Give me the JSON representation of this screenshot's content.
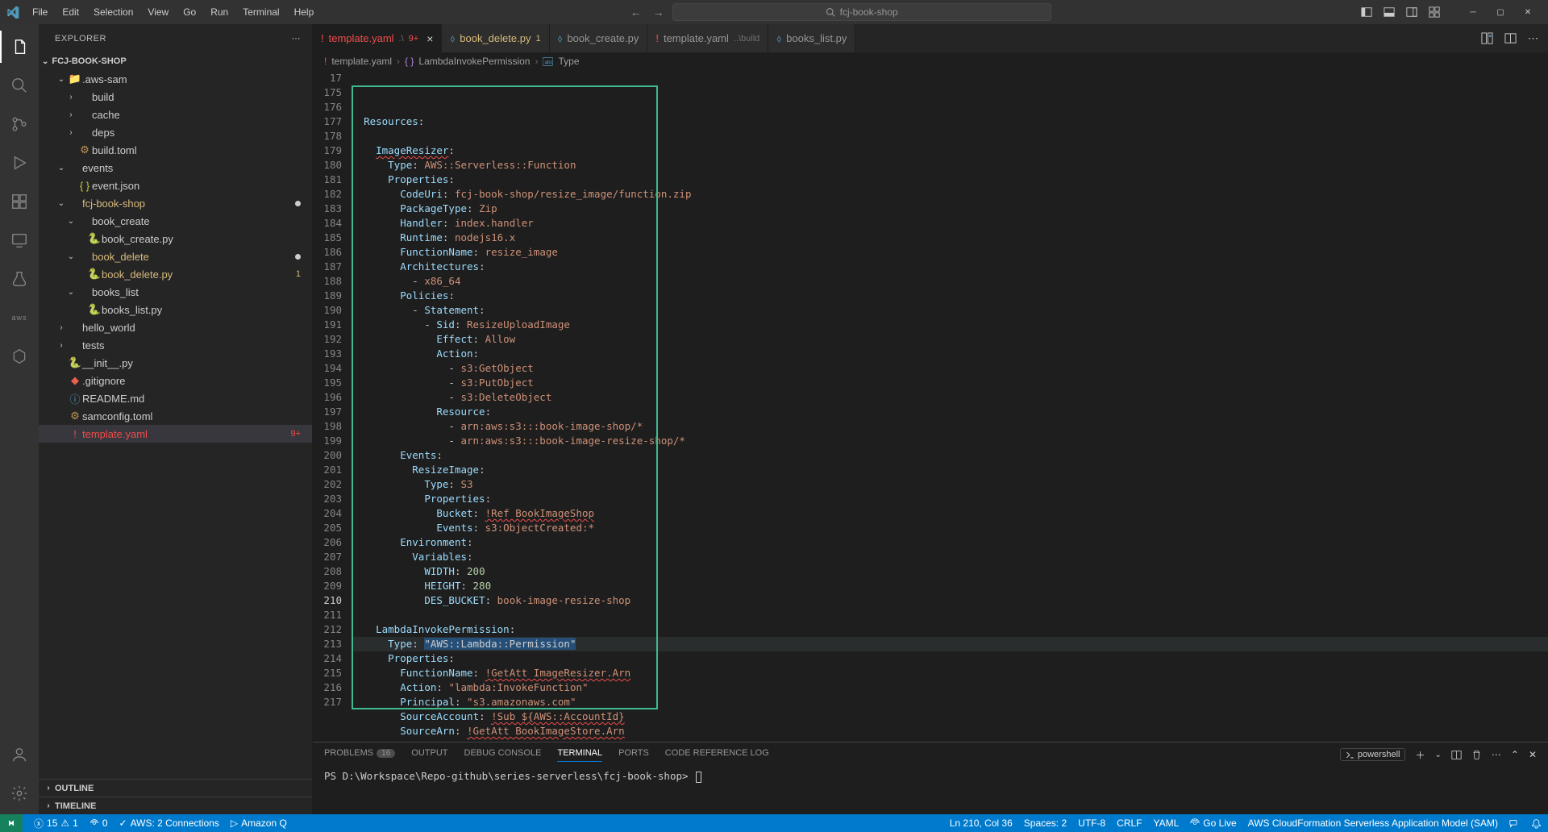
{
  "titlebar": {
    "menu": [
      "File",
      "Edit",
      "Selection",
      "View",
      "Go",
      "Run",
      "Terminal",
      "Help"
    ],
    "search": "fcj-book-shop"
  },
  "sidebar": {
    "title": "EXPLORER",
    "project": "FCJ-BOOK-SHOP",
    "tree": [
      {
        "indent": 1,
        "chev": "v",
        "icon": "folder",
        "label": ".aws-sam"
      },
      {
        "indent": 2,
        "chev": ">",
        "icon": "",
        "label": "build"
      },
      {
        "indent": 2,
        "chev": ">",
        "icon": "",
        "label": "cache"
      },
      {
        "indent": 2,
        "chev": ">",
        "icon": "",
        "label": "deps"
      },
      {
        "indent": 2,
        "chev": "",
        "icon": "toml",
        "label": "build.toml"
      },
      {
        "indent": 1,
        "chev": "v",
        "icon": "",
        "label": "events"
      },
      {
        "indent": 2,
        "chev": "",
        "icon": "json",
        "label": "event.json"
      },
      {
        "indent": 1,
        "chev": "v",
        "icon": "",
        "label": "fcj-book-shop",
        "modified": true,
        "dot": true
      },
      {
        "indent": 2,
        "chev": "v",
        "icon": "",
        "label": "book_create"
      },
      {
        "indent": 3,
        "chev": "",
        "icon": "py",
        "label": "book_create.py"
      },
      {
        "indent": 2,
        "chev": "v",
        "icon": "",
        "label": "book_delete",
        "modified": true,
        "dot": true
      },
      {
        "indent": 3,
        "chev": "",
        "icon": "py",
        "label": "book_delete.py",
        "modified": true,
        "badge": "1"
      },
      {
        "indent": 2,
        "chev": "v",
        "icon": "",
        "label": "books_list"
      },
      {
        "indent": 3,
        "chev": "",
        "icon": "py",
        "label": "books_list.py"
      },
      {
        "indent": 1,
        "chev": ">",
        "icon": "",
        "label": "hello_world"
      },
      {
        "indent": 1,
        "chev": ">",
        "icon": "",
        "label": "tests"
      },
      {
        "indent": 1,
        "chev": "",
        "icon": "py",
        "label": "__init__.py"
      },
      {
        "indent": 1,
        "chev": "",
        "icon": "git",
        "label": ".gitignore"
      },
      {
        "indent": 1,
        "chev": "",
        "icon": "info",
        "label": "README.md"
      },
      {
        "indent": 1,
        "chev": "",
        "icon": "toml",
        "label": "samconfig.toml"
      },
      {
        "indent": 1,
        "chev": "",
        "icon": "yaml",
        "label": "template.yaml",
        "selected": true,
        "redlabel": true,
        "badge": "9+"
      }
    ],
    "outline": "OUTLINE",
    "timeline": "TIMELINE"
  },
  "tabs": [
    {
      "icon": "yaml",
      "label": "template.yaml",
      "suffix": ".\\",
      "badge": "9+",
      "active": true,
      "close": true,
      "redlabel": true
    },
    {
      "icon": "py",
      "label": "book_delete.py",
      "badge": "1",
      "modified": true
    },
    {
      "icon": "py",
      "label": "book_create.py"
    },
    {
      "icon": "yaml",
      "label": "template.yaml",
      "suffix": "..\\build",
      "grey": true
    },
    {
      "icon": "py",
      "label": "books_list.py"
    }
  ],
  "breadcrumb": {
    "file": "template.yaml",
    "sym1": "LambdaInvokePermission",
    "sym2": "Type"
  },
  "code": {
    "start": 17,
    "lines": [
      {
        "n": 17,
        "html": "  <span class='kw'>Resources</span>:"
      },
      {
        "n": 175,
        "html": ""
      },
      {
        "n": 176,
        "html": "    <span class='kw wavy'>ImageResizer</span>:"
      },
      {
        "n": 177,
        "html": "      <span class='kw'>Type</span>: <span class='val'>AWS::Serverless::Function</span>"
      },
      {
        "n": 178,
        "html": "      <span class='kw'>Properties</span>:"
      },
      {
        "n": 179,
        "html": "        <span class='kw'>CodeUri</span>: <span class='val'>fcj-book-shop/resize_image/function.zip</span>"
      },
      {
        "n": 180,
        "html": "        <span class='kw'>PackageType</span>: <span class='val'>Zip</span>"
      },
      {
        "n": 181,
        "html": "        <span class='kw'>Handler</span>: <span class='val'>index.handler</span>"
      },
      {
        "n": 182,
        "html": "        <span class='kw'>Runtime</span>: <span class='val'>nodejs16.x</span>"
      },
      {
        "n": 183,
        "html": "        <span class='kw'>FunctionName</span>: <span class='val'>resize_image</span>"
      },
      {
        "n": 184,
        "html": "        <span class='kw'>Architectures</span>:"
      },
      {
        "n": 185,
        "html": "          - <span class='val'>x86_64</span>"
      },
      {
        "n": 186,
        "html": "        <span class='kw'>Policies</span>:"
      },
      {
        "n": 187,
        "html": "          - <span class='kw'>Statement</span>:"
      },
      {
        "n": 188,
        "html": "            - <span class='kw'>Sid</span>: <span class='val'>ResizeUploadImage</span>"
      },
      {
        "n": 189,
        "html": "              <span class='kw'>Effect</span>: <span class='val'>Allow</span>"
      },
      {
        "n": 190,
        "html": "              <span class='kw'>Action</span>:"
      },
      {
        "n": 191,
        "html": "                - <span class='val'>s3:GetObject</span>"
      },
      {
        "n": 192,
        "html": "                - <span class='val'>s3:PutObject</span>"
      },
      {
        "n": 193,
        "html": "                - <span class='val'>s3:DeleteObject</span>"
      },
      {
        "n": 194,
        "html": "              <span class='kw'>Resource</span>:"
      },
      {
        "n": 195,
        "html": "                - <span class='val'>arn:aws:s3:::book-image-shop/*</span>"
      },
      {
        "n": 196,
        "html": "                - <span class='val'>arn:aws:s3:::book-image-resize-shop/*</span>"
      },
      {
        "n": 197,
        "html": "        <span class='kw'>Events</span>:"
      },
      {
        "n": 198,
        "html": "          <span class='kw'>ResizeImage</span>:"
      },
      {
        "n": 199,
        "html": "            <span class='kw'>Type</span>: <span class='val'>S3</span>"
      },
      {
        "n": 200,
        "html": "            <span class='kw'>Properties</span>:"
      },
      {
        "n": 201,
        "html": "              <span class='kw'>Bucket</span>: <span class='ref'>!Ref BookImageShop</span>"
      },
      {
        "n": 202,
        "html": "              <span class='kw'>Events</span>: <span class='val'>s3:ObjectCreated:*</span>"
      },
      {
        "n": 203,
        "html": "        <span class='kw'>Environment</span>:"
      },
      {
        "n": 204,
        "html": "          <span class='kw'>Variables</span>:"
      },
      {
        "n": 205,
        "html": "            <span class='kw'>WIDTH</span>: <span class='num'>200</span>"
      },
      {
        "n": 206,
        "html": "            <span class='kw'>HEIGHT</span>: <span class='num'>280</span>"
      },
      {
        "n": 207,
        "html": "            <span class='kw'>DES_BUCKET</span>: <span class='val'>book-image-resize-shop</span>"
      },
      {
        "n": 208,
        "html": ""
      },
      {
        "n": 209,
        "html": "    <span class='kw'>LambdaInvokePermission</span>:"
      },
      {
        "n": 210,
        "html": "      <span class='kw'>Type</span>: <span class='selection'>\"AWS::Lambda::Permission\"</span>",
        "active": true
      },
      {
        "n": 211,
        "html": "      <span class='kw'>Properties</span>:"
      },
      {
        "n": 212,
        "html": "        <span class='kw'>FunctionName</span>: <span class='ref'>!GetAtt ImageResizer.Arn</span>"
      },
      {
        "n": 213,
        "html": "        <span class='kw'>Action</span>: <span class='str'>\"lambda:InvokeFunction\"</span>"
      },
      {
        "n": 214,
        "html": "        <span class='kw'>Principal</span>: <span class='str'>\"s3.amazonaws.com\"</span>"
      },
      {
        "n": 215,
        "html": "        <span class='kw'>SourceAccount</span>: <span class='ref'>!Sub ${AWS::AccountId}</span>"
      },
      {
        "n": 216,
        "html": "        <span class='kw'>SourceArn</span>: <span class='ref'>!GetAtt BookImageStore.Arn</span>"
      },
      {
        "n": 217,
        "html": ""
      }
    ]
  },
  "panel": {
    "tabs": [
      {
        "label": "PROBLEMS",
        "count": "16"
      },
      {
        "label": "OUTPUT"
      },
      {
        "label": "DEBUG CONSOLE"
      },
      {
        "label": "TERMINAL",
        "active": true
      },
      {
        "label": "PORTS"
      },
      {
        "label": "CODE REFERENCE LOG"
      }
    ],
    "shell": "powershell",
    "prompt": "PS D:\\Workspace\\Repo-github\\series-serverless\\fcj-book-shop> "
  },
  "status": {
    "errors": "15",
    "warnings": "1",
    "ports": "0",
    "aws": "AWS: 2 Connections",
    "amazonq": "Amazon Q",
    "ln": "Ln 210, Col 36",
    "spaces": "Spaces: 2",
    "enc": "UTF-8",
    "eol": "CRLF",
    "lang": "YAML",
    "golive": "Go Live",
    "sam": "AWS CloudFormation Serverless Application Model (SAM)"
  }
}
